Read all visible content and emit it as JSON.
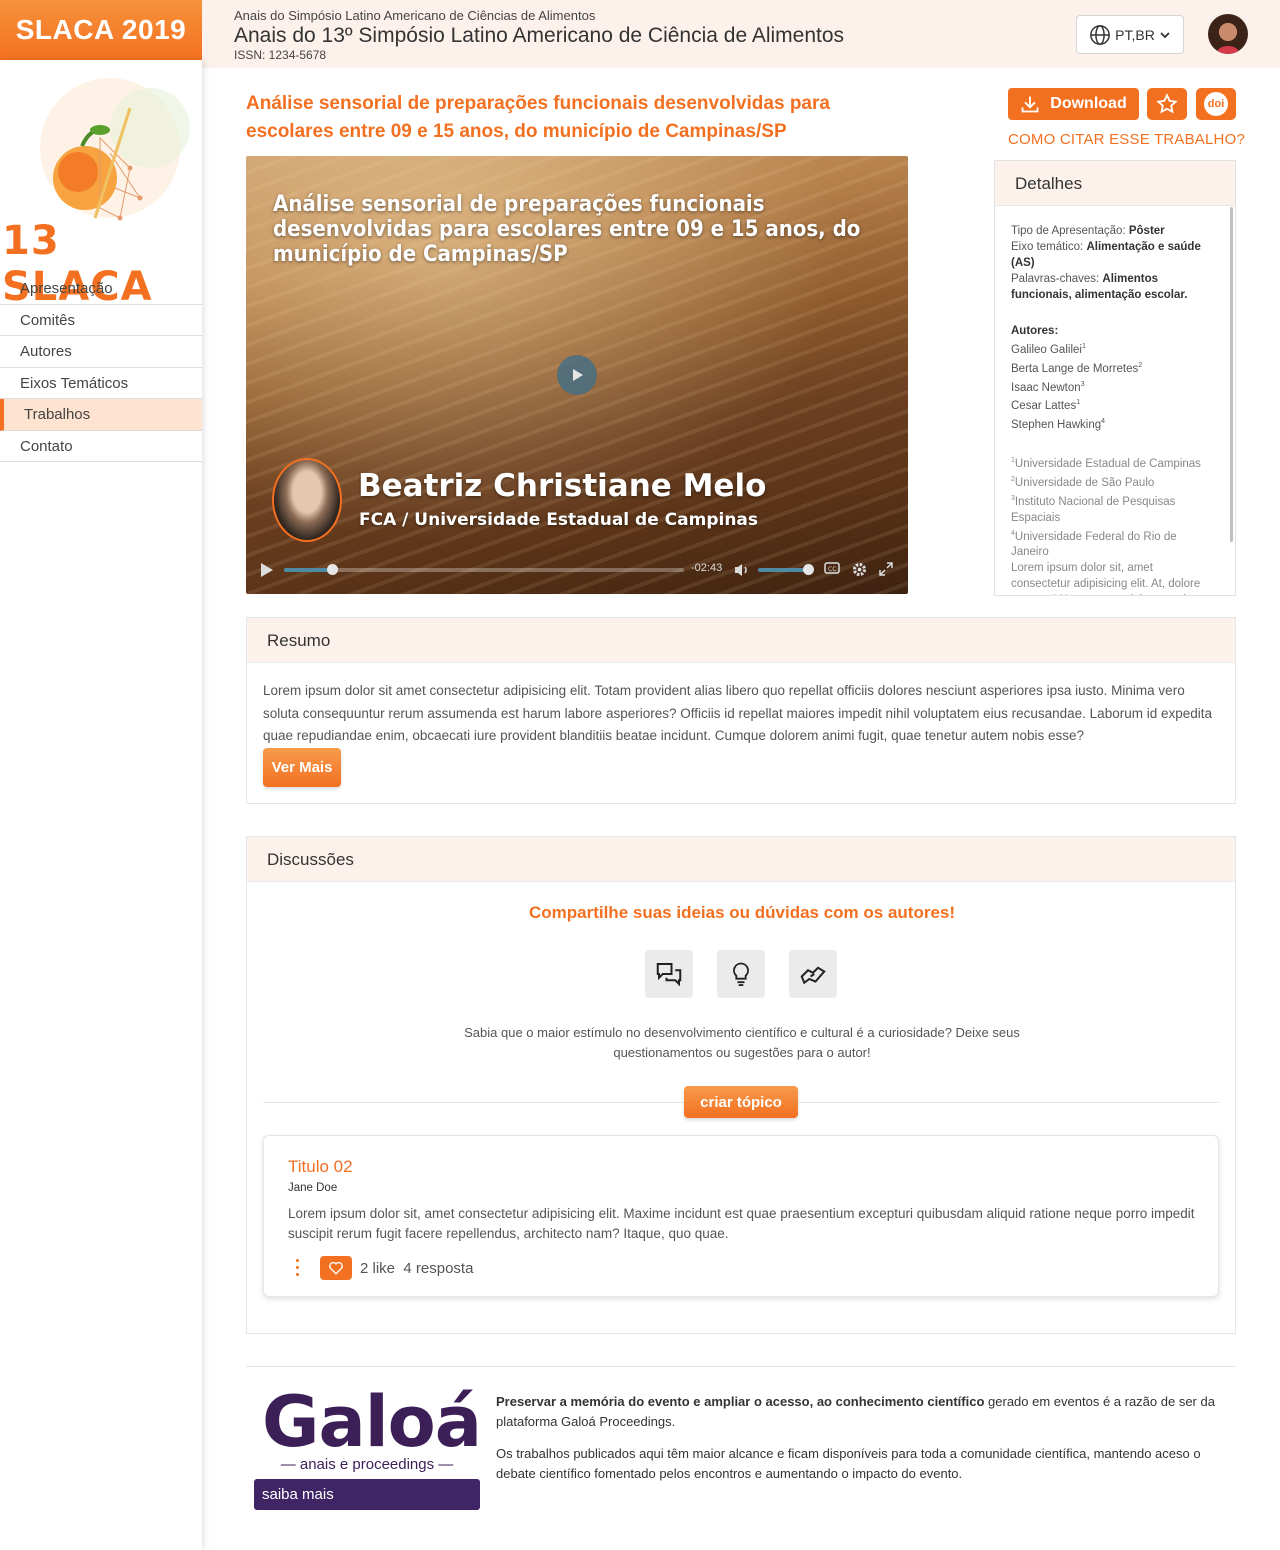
{
  "header": {
    "brand": "SLACA 2019",
    "subtitle": "Anais do Simpósio Latino Americano de Ciências de Alimentos",
    "title": "Anais do 13º Simpósio Latino Americano de Ciência de Alimentos",
    "issn": "ISSN: 1234-5678",
    "language": "PT,BR"
  },
  "sidebar": {
    "logo_text": "13 SLACA",
    "items": [
      {
        "label": "Apresentação"
      },
      {
        "label": "Comitês"
      },
      {
        "label": "Autores"
      },
      {
        "label": "Eixos Temáticos"
      },
      {
        "label": "Trabalhos",
        "active": true
      },
      {
        "label": "Contato"
      }
    ]
  },
  "work": {
    "title": "Análise sensorial de preparações funcionais desenvolvidas para escolares entre 09 e 15 anos, do município de Campinas/SP",
    "download_label": "Download",
    "doi_label": "doi",
    "cite_label": "COMO CITAR ESSE TRABALHO?"
  },
  "video": {
    "title": "Análise sensorial de preparações funcionais desenvolvidas para escolares entre 09 e 15 anos, do município de Campinas/SP",
    "presenter_name": "Beatriz Christiane Melo",
    "presenter_affiliation": "FCA / Universidade Estadual de Campinas",
    "time_remaining": "-02:43",
    "progress": 0.12,
    "volume": 1.0
  },
  "details": {
    "heading": "Detalhes",
    "presentation_type_label": "Tipo de Apresentação:",
    "presentation_type": "Pôster",
    "axis_label": "Eixo temático:",
    "axis": "Alimentação e saúde (AS)",
    "keywords_label": "Palavras-chaves:",
    "keywords": "Alimentos funcionais, alimentação escolar.",
    "authors_label": "Autores:",
    "authors": [
      {
        "name": "Galileo Galilei",
        "sup": "1"
      },
      {
        "name": "Berta Lange de Morretes",
        "sup": "2"
      },
      {
        "name": "Isaac Newton",
        "sup": "3"
      },
      {
        "name": "Cesar Lattes",
        "sup": "1"
      },
      {
        "name": "Stephen Hawking",
        "sup": "4"
      }
    ],
    "affiliations": [
      {
        "sup": "1",
        "name": "Universidade Estadual de Campinas"
      },
      {
        "sup": "2",
        "name": "Universidade de São Paulo"
      },
      {
        "sup": "3",
        "name": "Instituto Nacional de Pesquisas Espaciais"
      },
      {
        "sup": "4",
        "name": "Universidade Federal do Rio de Janeiro"
      }
    ],
    "extra_text": "Lorem ipsum dolor sit, amet consectetur adipisicing elit. At, dolore tempore! Nemo esse minima omnis obcaecati, perferendis temporibus"
  },
  "resumo": {
    "heading": "Resumo",
    "text": "Lorem ipsum dolor sit amet consectetur adipisicing elit. Totam provident alias libero quo repellat officiis dolores nesciunt asperiores ipsa iusto. Minima vero soluta consequuntur rerum assumenda est harum labore asperiores? Officiis id repellat maiores impedit nihil voluptatem eius recusandae. Laborum id expedita quae repudiandae enim, obcaecati iure provident blanditiis beatae incidunt. Cumque dolorem animi fugit, quae tenetur autem nobis esse?",
    "more_label": "Ver Mais"
  },
  "discussions": {
    "heading": "Discussões",
    "cta": "Compartilhe suas ideias ou dúvidas com os autores!",
    "text": "Sabia que o maior estímulo no desenvolvimento científico e cultural é a curiosidade? Deixe seus questionamentos ou sugestões para o autor!",
    "create_label": "criar tópico",
    "icons": [
      "chat-icon",
      "lightbulb-icon",
      "handshake-icon"
    ],
    "topics": [
      {
        "title": "Titulo 02",
        "author": "Jane Doe",
        "text": "Lorem ipsum dolor sit, amet consectetur adipisicing elit. Maxime incidunt est quae praesentium excepturi quibusdam aliquid ratione neque porro impedit suscipit rerum fugit facere repellendus, architecto nam? Itaque, quo quae.",
        "likes": "2 like",
        "replies": "4 resposta"
      }
    ]
  },
  "footer": {
    "logo": "Galoá",
    "logo_sub": "anais e proceedings",
    "button": "saiba mais",
    "p1_bold": "Preservar a memória do evento e ampliar o acesso, ao conhecimento científico",
    "p1_rest": " gerado em eventos é a razão de ser da plataforma Galoá Proceedings.",
    "p2": "Os trabalhos publicados aqui têm maior alcance e ficam disponíveis para toda a comunidade científica, mantendo aceso o debate científico fomentado pelos encontros e aumentando o impacto do evento."
  },
  "colors": {
    "accent": "#f37021",
    "header_bg": "#fdf1ec",
    "galoa_purple": "#3c1f56"
  }
}
